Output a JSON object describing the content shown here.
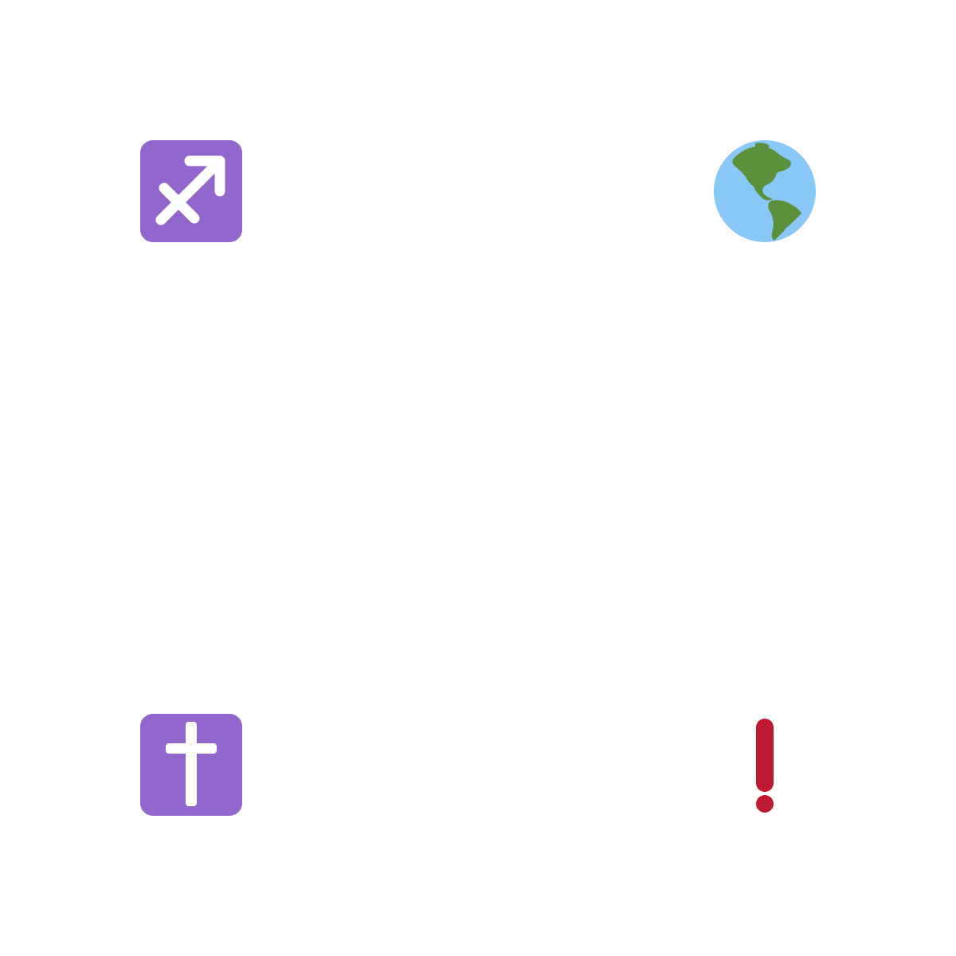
{
  "icons": [
    {
      "name": "sagittarius-icon",
      "background": "#9266CC",
      "glyph_color": "#FFFFFF"
    },
    {
      "name": "globe-showing-americas-icon",
      "ocean": "#88C9F9",
      "land": "#5C913B"
    },
    {
      "name": "latin-cross-icon",
      "background": "#9266CC",
      "glyph_color": "#FFFFFF"
    },
    {
      "name": "exclamation-mark-icon",
      "color": "#BE1931"
    }
  ]
}
